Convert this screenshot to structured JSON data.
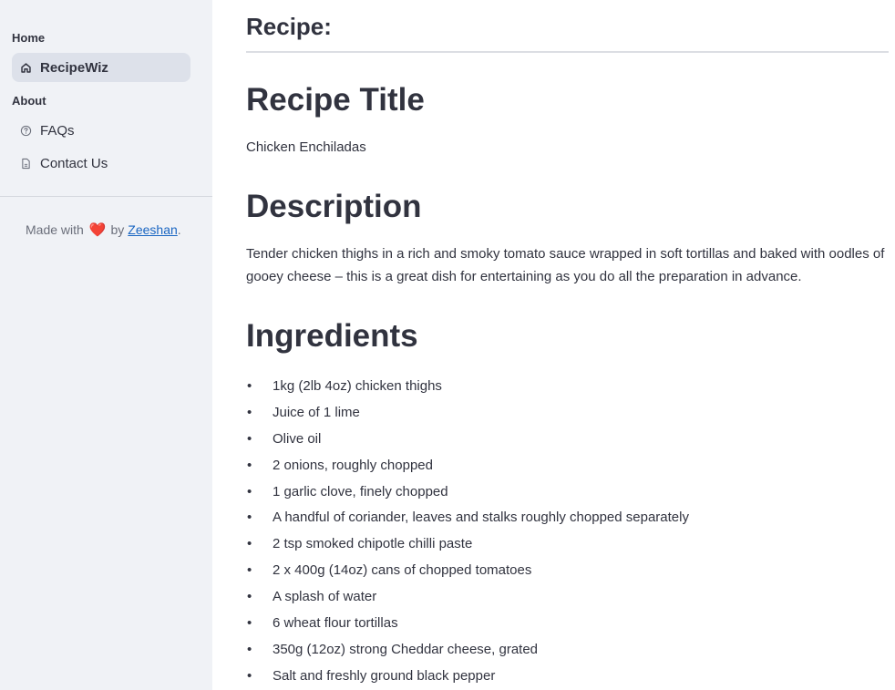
{
  "sidebar": {
    "sections": [
      {
        "label": "Home",
        "items": [
          {
            "label": "RecipeWiz",
            "icon": "home-icon",
            "active": true
          }
        ]
      },
      {
        "label": "About",
        "items": [
          {
            "label": "FAQs",
            "icon": "question-circle-icon",
            "active": false
          },
          {
            "label": "Contact Us",
            "icon": "document-icon",
            "active": false
          }
        ]
      }
    ],
    "footer": {
      "prefix": "Made with",
      "heart": "❤️",
      "by": "by",
      "author": "Zeeshan",
      "suffix": "."
    }
  },
  "main": {
    "header": "Recipe:",
    "title_heading": "Recipe Title",
    "title_value": "Chicken Enchiladas",
    "description_heading": "Description",
    "description_text": "Tender chicken thighs in a rich and smoky tomato sauce wrapped in soft tortillas and baked with oodles of gooey cheese – this is a great dish for entertaining as you do all the preparation in advance.",
    "ingredients_heading": "Ingredients",
    "ingredients": [
      "1kg (2lb 4oz) chicken thighs",
      "Juice of 1 lime",
      "Olive oil",
      "2 onions, roughly chopped",
      "1 garlic clove, finely chopped",
      "A handful of coriander, leaves and stalks roughly chopped separately",
      "2 tsp smoked chipotle chilli paste",
      "2 x 400g (14oz) cans of chopped tomatoes",
      "A splash of water",
      "6 wheat flour tortillas",
      "350g (12oz) strong Cheddar cheese, grated",
      "Salt and freshly ground black pepper"
    ]
  },
  "colors": {
    "sidebar_bg": "#f0f2f6",
    "active_item_bg": "#dde1ea",
    "text": "#31333f",
    "link": "#1a66c2",
    "heart": "#e0243a"
  }
}
